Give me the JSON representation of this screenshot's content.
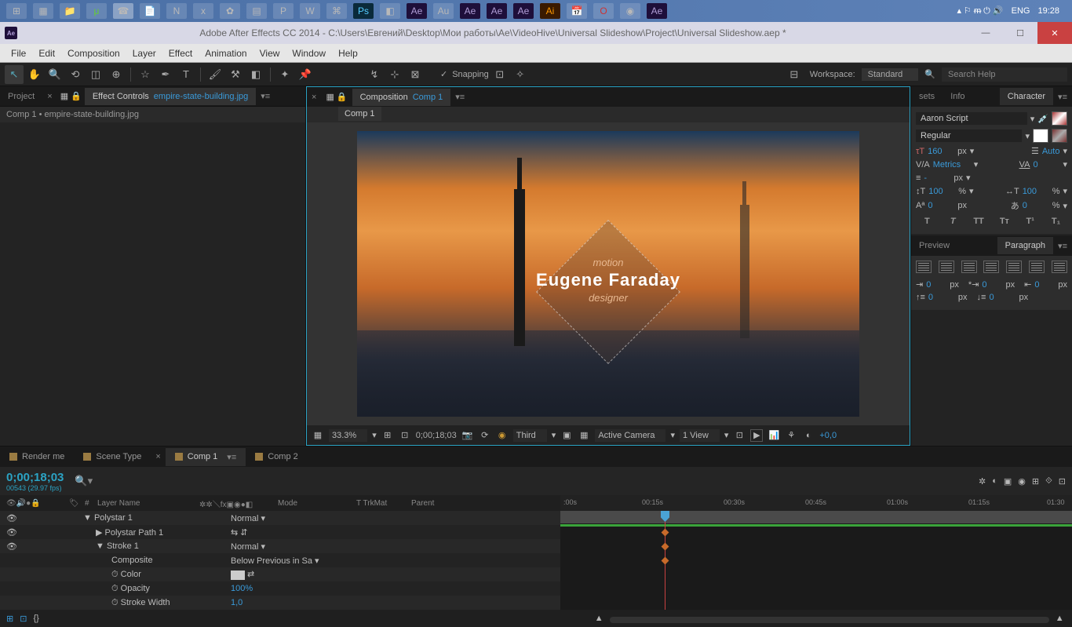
{
  "taskbar": {
    "tray": {
      "lang": "ENG",
      "time": "19:28"
    }
  },
  "window": {
    "title": "Adobe After Effects CC 2014 - C:\\Users\\Евгений\\Desktop\\Мои работы\\Ae\\VideoHive\\Universal Slideshow\\Project\\Universal Slideshow.aep *"
  },
  "menus": [
    "File",
    "Edit",
    "Composition",
    "Layer",
    "Effect",
    "Animation",
    "View",
    "Window",
    "Help"
  ],
  "toolbar": {
    "snapping": "Snapping",
    "workspace_label": "Workspace:",
    "workspace_value": "Standard",
    "search_placeholder": "Search Help"
  },
  "panels": {
    "project_tab": "Project",
    "effect_controls_tab": "Effect Controls",
    "effect_file": "empire-state-building.jpg",
    "effect_breadcrumb": "Comp 1 • empire-state-building.jpg",
    "composition_tab": "Composition",
    "comp_active": "Comp 1",
    "comp_tab_label": "Comp 1"
  },
  "preview": {
    "subtitle_top": "motion",
    "title": "Eugene Faraday",
    "subtitle_bottom": "designer"
  },
  "comp_footer": {
    "zoom": "33.3%",
    "timecode": "0;00;18;03",
    "resolution": "Third",
    "camera": "Active Camera",
    "views": "1 View",
    "exposure": "+0,0"
  },
  "right": {
    "sets": "sets",
    "info": "Info",
    "character": "Character",
    "font": "Aaron Script",
    "style": "Regular",
    "size": "160",
    "size_unit": "px",
    "leading": "Auto",
    "kerning": "Metrics",
    "tracking": "0",
    "stroke_unit": "px",
    "vscale": "100",
    "vscale_unit": "%",
    "hscale": "100",
    "hscale_unit": "%",
    "baseline": "0",
    "baseline_unit": "px",
    "tsume": "0",
    "tsume_unit": "%",
    "btn_T": "T",
    "btn_TT": "TT",
    "btn_Tt": "Tᴛ",
    "btn_sup": "T¹",
    "btn_sub": "T₁",
    "preview_tab": "Preview",
    "paragraph_tab": "Paragraph",
    "ind_val": "0",
    "ind_unit": "px"
  },
  "timeline": {
    "tabs": {
      "render": "Render me",
      "scene": "Scene Type",
      "comp1": "Comp 1",
      "comp2": "Comp 2"
    },
    "current_time": "0;00;18;03",
    "frame_info": "00543 (29.97 fps)",
    "col_layer_name": "Layer Name",
    "col_mode": "Mode",
    "col_trkmat": "T  TrkMat",
    "col_parent": "Parent",
    "ticks": [
      ":00s",
      "00:15s",
      "00:30s",
      "00:45s",
      "01:00s",
      "01:15s",
      "01:30"
    ],
    "rows": {
      "polystar": "Polystar 1",
      "polystar_mode": "Normal",
      "polypath": "Polystar Path 1",
      "stroke": "Stroke 1",
      "stroke_mode": "Normal",
      "composite": "Composite",
      "composite_val": "Below Previous in Sa",
      "color": "Color",
      "opacity": "Opacity",
      "opacity_val": "100%",
      "stroke_width": "Stroke Width",
      "stroke_width_val": "1,0"
    }
  }
}
